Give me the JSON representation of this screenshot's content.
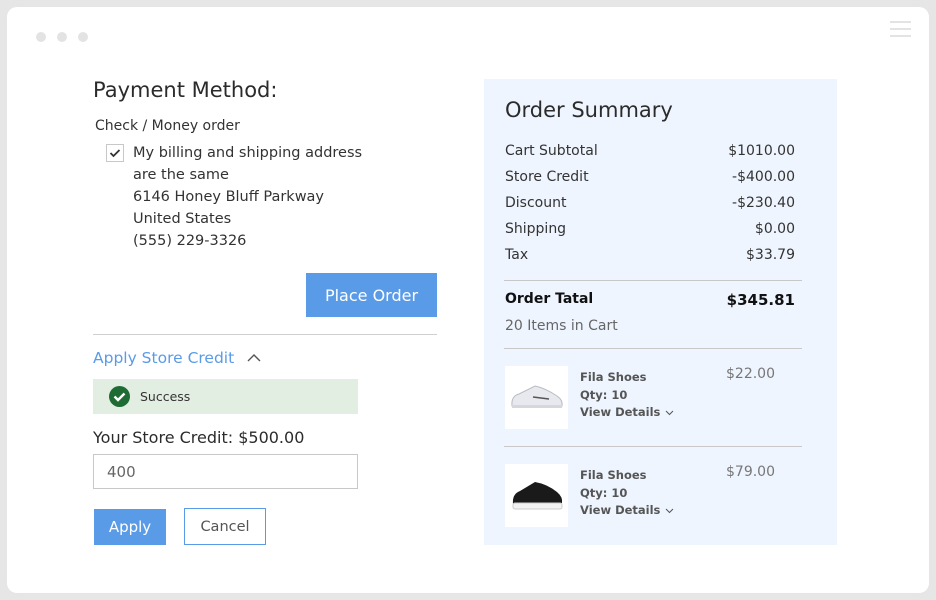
{
  "payment": {
    "title": "Payment Method:",
    "method": "Check / Money order",
    "same_address_checked": true,
    "address_lines": [
      "My billing and shipping address",
      "are the same",
      "6146 Honey Bluff Parkway",
      "United States",
      "(555) 229-3326"
    ],
    "place_order": "Place Order"
  },
  "credit": {
    "toggle": "Apply Store Credit",
    "status": "Success",
    "balance": "Your Store Credit: $500.00",
    "amount_value": "400",
    "apply": "Apply",
    "cancel": "Cancel"
  },
  "summary": {
    "title": "Order Summary",
    "rows": [
      {
        "label": "Cart Subtotal",
        "value": "$1010.00"
      },
      {
        "label": "Store Credit",
        "value": "-$400.00"
      },
      {
        "label": "Discount",
        "value": "-$230.40"
      },
      {
        "label": "Shipping",
        "value": "$0.00"
      },
      {
        "label": "Tax",
        "value": "$33.79"
      }
    ],
    "total_label": "Order Tatal",
    "total_value": "$345.81",
    "items_count": "20 Items in Cart",
    "items": [
      {
        "name": "Fila Shoes",
        "qty": "Qty: 10",
        "details": "View Details",
        "price": "$22.00",
        "color": "white"
      },
      {
        "name": "Fila Shoes",
        "qty": "Qty: 10",
        "details": "View Details",
        "price": "$79.00",
        "color": "black"
      }
    ]
  },
  "colors": {
    "accent": "#5a9be8",
    "success_bg": "#e3eee2",
    "success_icon": "#1e6b34",
    "summary_bg": "#eef5ff"
  }
}
